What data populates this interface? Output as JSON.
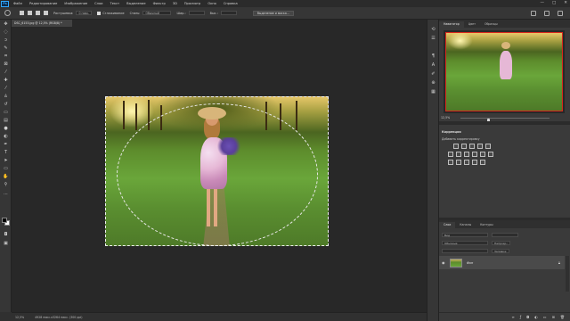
{
  "menu": {
    "logo": "Ps",
    "items": [
      "Файл",
      "Редактирование",
      "Изображение",
      "Слои",
      "Текст",
      "Выделение",
      "Фильтр",
      "3D",
      "Просмотр",
      "Окно",
      "Справка"
    ],
    "window_controls": [
      "—",
      "□",
      "✕"
    ]
  },
  "options": {
    "feather_label": "Растушевка:",
    "feather_value": "0 пикс.",
    "antialias_label": "Сглаживание",
    "style_label": "Стиль:",
    "style_value": "Обычный",
    "width_label": "Шир.:",
    "height_label": "Выс.:",
    "select_mask_button": "Выделение и маска..."
  },
  "document": {
    "tab_title": "DSC_6153.jpg @ 12,5% (RGB/8) *",
    "status_zoom": "12,5%",
    "status_info": "4928 пикс.х3264 пикс. (300 ppi)"
  },
  "navigator": {
    "tabs": [
      "Навигатор",
      "Цвет",
      "Образцы"
    ],
    "zoom": "12,5%"
  },
  "adjustments": {
    "title": "Коррекция",
    "subtitle": "Добавить корректировку"
  },
  "layers": {
    "tabs": [
      "Слои",
      "Каналы",
      "Контуры"
    ],
    "kind_placeholder": "Вид",
    "blend_mode": "Обычные",
    "opacity_label": "Непрозр.:",
    "fill_label": "Заливка:",
    "items": [
      {
        "name": "Фон",
        "visible": true,
        "locked": true
      }
    ]
  },
  "icons": {
    "eye": "eye-icon",
    "lock": "lock-icon"
  }
}
